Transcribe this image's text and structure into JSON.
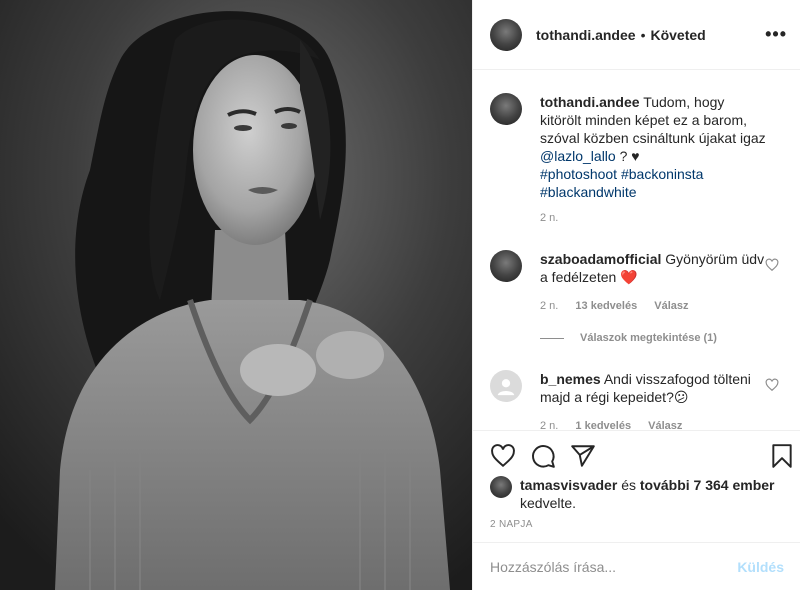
{
  "header": {
    "username": "tothandi.andee",
    "separator": "•",
    "follow_status": "Követed",
    "more_label": "•••"
  },
  "caption": {
    "username": "tothandi.andee",
    "text": "Tudom, hogy kitörölt minden képet ez a barom, szóval közben csináltunk újakat igaz",
    "mention": "@lazlo_lallo",
    "suffix": "? ♥",
    "hashtags": [
      "#photoshoot",
      "#backoninsta",
      "#blackandwhite"
    ],
    "time": "2 n."
  },
  "comments": [
    {
      "username": "szaboadamofficial",
      "text": "Gyönyörüm üdv a fedélzeten",
      "emoji": "❤️",
      "time": "2 n.",
      "likes": "13 kedvelés",
      "reply": "Válasz",
      "view_replies": "Válaszok megtekintése (1)"
    },
    {
      "username": "b_nemes",
      "text": "Andi visszafogod tölteni majd a régi kepeidet?",
      "emoji": "😕",
      "time": "2 n.",
      "likes": "1 kedvelés",
      "reply": "Válasz"
    }
  ],
  "likes": {
    "username": "tamasvisvader",
    "connector": "és",
    "others": "további 7 364 ember",
    "suffix": "kedvelte."
  },
  "date": "2 NAPJA",
  "composer": {
    "placeholder": "Hozzászólás írása...",
    "send_label": "Küldés"
  },
  "icons": {
    "like": "heart-icon",
    "comment": "comment-icon",
    "share": "paper-plane-icon",
    "save": "bookmark-icon"
  }
}
